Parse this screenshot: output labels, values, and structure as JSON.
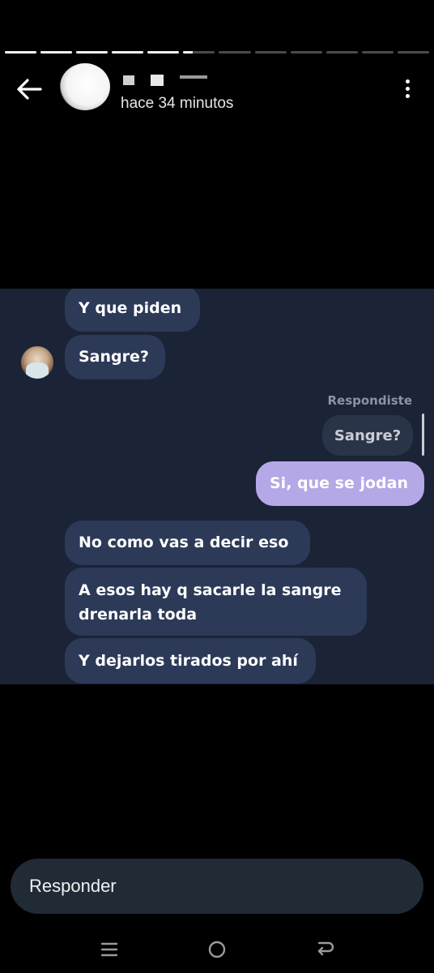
{
  "story": {
    "progress_segments": [
      1,
      1,
      1,
      1,
      1,
      0.3,
      0,
      0,
      0,
      0,
      0,
      0
    ],
    "subtitle": "hace 34 minutos",
    "back_icon": "arrow-left-icon",
    "more_icon": "more-vertical-icon"
  },
  "chat": {
    "messages_top": [
      {
        "text": "Y que piden",
        "side": "in"
      },
      {
        "text": "Sangre?",
        "side": "in"
      }
    ],
    "replied_label": "Respondiste",
    "quoted_text": "Sangre?",
    "my_reply": "Si, que se jodan",
    "messages_bottom": [
      {
        "text": "No como vas a decir eso"
      },
      {
        "text_line1": "A esos hay q sacarle la sangre",
        "text_line2": "drenarla toda"
      },
      {
        "text": "Y dejarlos tirados por ahí"
      }
    ],
    "colors": {
      "background": "#1b2336",
      "incoming_bubble": "#2c3a58",
      "outgoing_bubble": "#b5a8e6"
    }
  },
  "reply_bar": {
    "placeholder": "Responder"
  },
  "nav": {
    "recent_icon": "recent-apps-icon",
    "home_icon": "home-icon",
    "back_icon": "back-icon"
  }
}
